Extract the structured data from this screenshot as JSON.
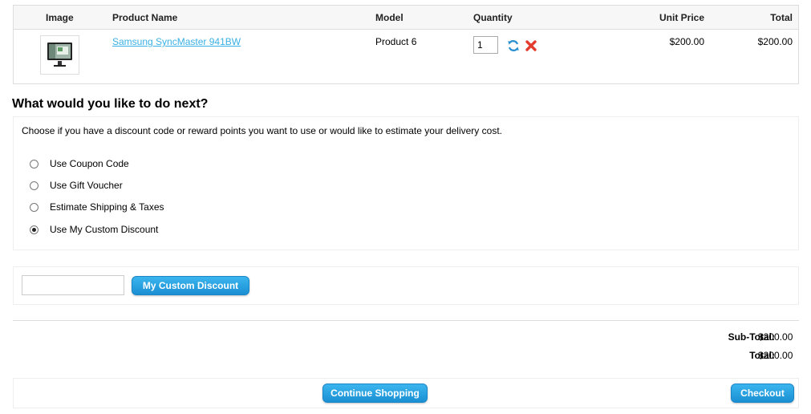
{
  "cart": {
    "headers": {
      "image": "Image",
      "product_name": "Product Name",
      "model": "Model",
      "quantity": "Quantity",
      "unit_price": "Unit Price",
      "total": "Total"
    },
    "rows": [
      {
        "product_name": "Samsung SyncMaster 941BW",
        "model": "Product 6",
        "quantity": "1",
        "unit_price": "$200.00",
        "total": "$200.00"
      }
    ],
    "icons": {
      "update": "refresh-icon",
      "remove": "remove-icon"
    }
  },
  "next": {
    "title": "What would you like to do next?",
    "intro": "Choose if you have a discount code or reward points you want to use or would like to estimate your delivery cost.",
    "options": [
      {
        "label": "Use Coupon Code",
        "checked": false
      },
      {
        "label": "Use Gift Voucher",
        "checked": false
      },
      {
        "label": "Estimate Shipping & Taxes",
        "checked": false
      },
      {
        "label": "Use My Custom Discount",
        "checked": true
      }
    ]
  },
  "discount": {
    "input_value": "",
    "button_label": "My Custom Discount"
  },
  "totals": {
    "sub_total_label": "Sub-Total:",
    "sub_total_value": "$200.00",
    "total_label": "Total:",
    "total_value": "$200.00"
  },
  "actions": {
    "continue_label": "Continue Shopping",
    "checkout_label": "Checkout"
  },
  "colors": {
    "link": "#38b0e3",
    "button": "#1a8fd3",
    "remove_icon": "#e33b2e"
  }
}
